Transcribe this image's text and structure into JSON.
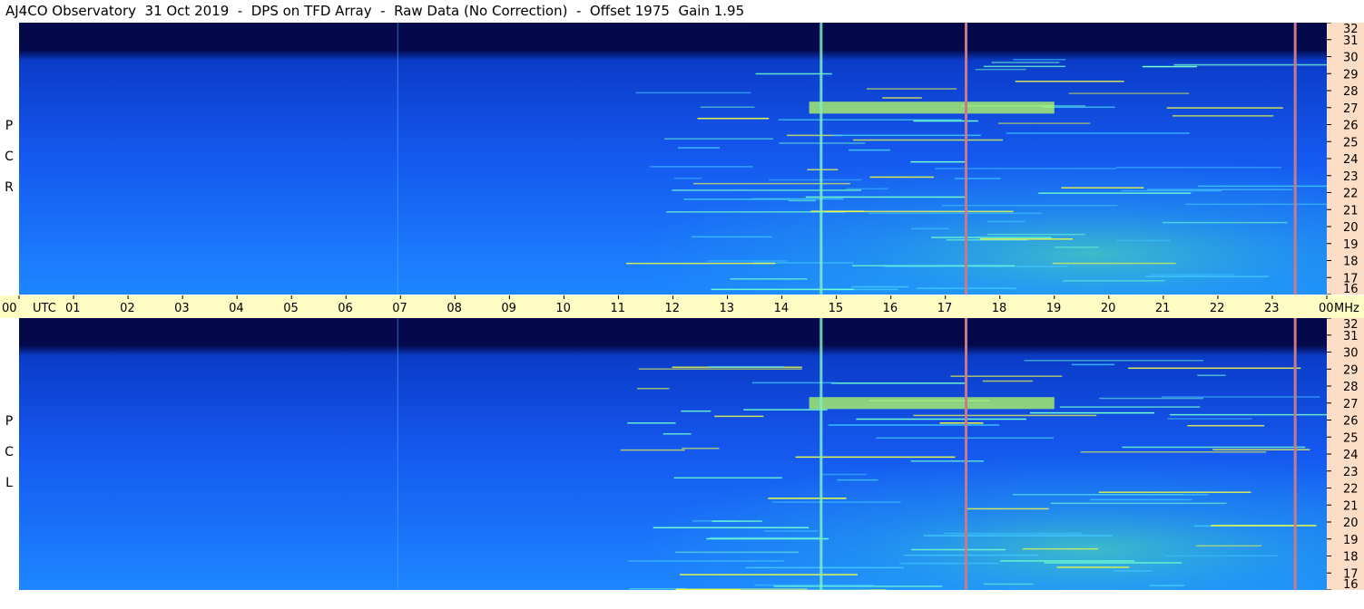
{
  "title": "AJ4CO Observatory  31 Oct 2019  -  DPS on TFD Array  -  Raw Data (No Correction)  -  Offset 1975  Gain 1.95",
  "panels": [
    {
      "id": "rcp",
      "label_letters": [
        "P",
        "C",
        "R"
      ]
    },
    {
      "id": "lcp",
      "label_letters": [
        "P",
        "C",
        "L"
      ]
    }
  ],
  "time_axis": {
    "labels": [
      "00",
      "01",
      "02",
      "03",
      "04",
      "05",
      "06",
      "07",
      "08",
      "09",
      "10",
      "11",
      "12",
      "13",
      "14",
      "15",
      "16",
      "17",
      "18",
      "19",
      "20",
      "21",
      "22",
      "23",
      "00"
    ],
    "unit": "UTC",
    "freq_unit": "MHz"
  },
  "chart_data": {
    "type": "heatmap",
    "title": "AJ4CO Observatory  31 Oct 2019  -  DPS on TFD Array  -  Raw Data (No Correction)  -  Offset 1975  Gain 1.95",
    "x_axis": {
      "label": "UTC",
      "range_hours": [
        0,
        24
      ],
      "ticks": [
        "00",
        "01",
        "02",
        "03",
        "04",
        "05",
        "06",
        "07",
        "08",
        "09",
        "10",
        "11",
        "12",
        "13",
        "14",
        "15",
        "16",
        "17",
        "18",
        "19",
        "20",
        "21",
        "22",
        "23",
        "00"
      ]
    },
    "y_axis": {
      "label": "MHz",
      "range": [
        16,
        32
      ],
      "ticks": [
        16,
        17,
        18,
        19,
        20,
        21,
        22,
        23,
        24,
        25,
        26,
        27,
        28,
        29,
        30,
        31,
        32
      ]
    },
    "series": [
      {
        "name": "RCP"
      },
      {
        "name": "LCP"
      }
    ],
    "features": {
      "vertical_lines_utc": [
        6.95,
        14.72,
        17.38,
        23.42
      ],
      "bright_band_mhz": 27.0,
      "bright_band_utc": [
        14.5,
        19.0
      ],
      "dark_region_above_mhz": 30.7
    }
  },
  "colors": {
    "background": "#ffffff",
    "time_bar": "#fffdc4",
    "freq_panel": "#fbdcc5",
    "spectrum_low": "#03094a",
    "spectrum_mid": "#1a6cff",
    "spectrum_high": "#5cf0a0",
    "marker": "#c87a8a"
  }
}
